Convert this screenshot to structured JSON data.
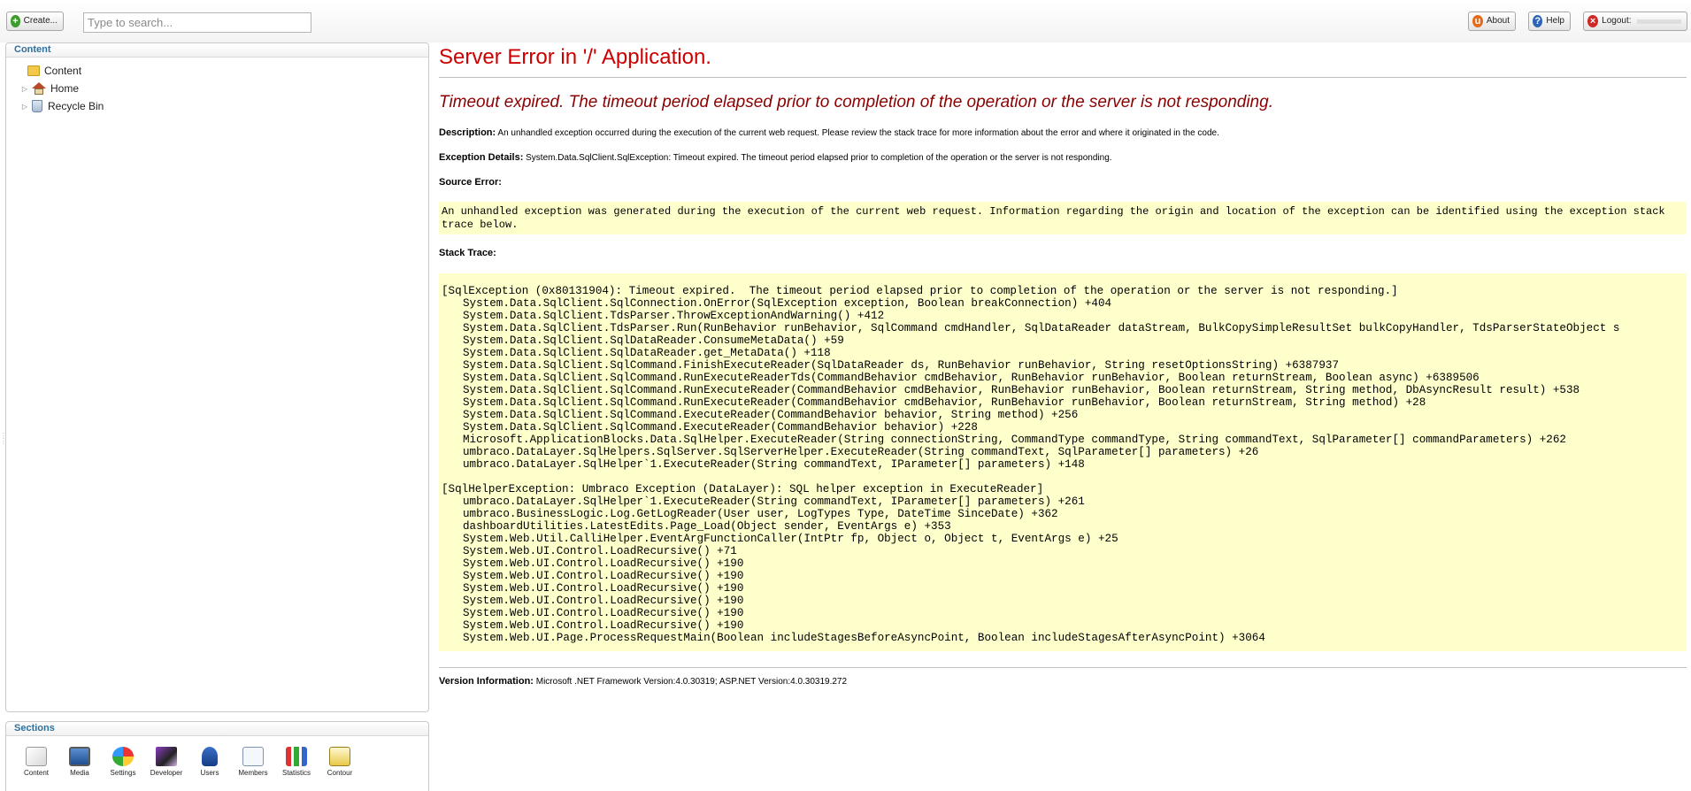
{
  "toolbar": {
    "create_label": "Create...",
    "search_placeholder": "Type to search...",
    "about_label": "About",
    "help_label": "Help",
    "logout_label": "Logout:"
  },
  "content_panel": {
    "title": "Content",
    "tree": [
      {
        "label": "Content",
        "icon": "folder-icon"
      },
      {
        "label": "Home",
        "icon": "home-icon"
      },
      {
        "label": "Recycle Bin",
        "icon": "recycle-bin-icon"
      }
    ]
  },
  "sections_panel": {
    "title": "Sections",
    "items": [
      {
        "label": "Content",
        "icon": "content-icon"
      },
      {
        "label": "Media",
        "icon": "media-icon"
      },
      {
        "label": "Settings",
        "icon": "settings-icon"
      },
      {
        "label": "Developer",
        "icon": "developer-icon"
      },
      {
        "label": "Users",
        "icon": "users-icon"
      },
      {
        "label": "Members",
        "icon": "members-icon"
      },
      {
        "label": "Statistics",
        "icon": "statistics-icon"
      },
      {
        "label": "Contour",
        "icon": "contour-icon"
      }
    ]
  },
  "error": {
    "title": "Server Error in '/' Application.",
    "message": "Timeout expired.  The timeout period elapsed prior to completion of the operation or the server is not responding.",
    "description_label": "Description:",
    "description_text": " An unhandled exception occurred during the execution of the current web request. Please review the stack trace for more information about the error and where it originated in the code.",
    "exception_label": "Exception Details:",
    "exception_text": " System.Data.SqlClient.SqlException: Timeout expired.  The timeout period elapsed prior to completion of the operation or the server is not responding.",
    "source_error_label": "Source Error:",
    "source_error_text": "An unhandled exception was generated during the execution of the current web request. Information regarding the origin and location of the exception can be identified using the exception stack trace below.",
    "stack_trace_label": "Stack Trace:",
    "stack_trace": [
      {
        "text": "[SqlException (0x80131904): Timeout expired.  The timeout period elapsed prior to completion of the operation or the server is not responding.]",
        "indent": false
      },
      {
        "text": "System.Data.SqlClient.SqlConnection.OnError(SqlException exception, Boolean breakConnection) +404",
        "indent": true
      },
      {
        "text": "System.Data.SqlClient.TdsParser.ThrowExceptionAndWarning() +412",
        "indent": true
      },
      {
        "text": "System.Data.SqlClient.TdsParser.Run(RunBehavior runBehavior, SqlCommand cmdHandler, SqlDataReader dataStream, BulkCopySimpleResultSet bulkCopyHandler, TdsParserStateObject s",
        "indent": true
      },
      {
        "text": "System.Data.SqlClient.SqlDataReader.ConsumeMetaData() +59",
        "indent": true
      },
      {
        "text": "System.Data.SqlClient.SqlDataReader.get_MetaData() +118",
        "indent": true
      },
      {
        "text": "System.Data.SqlClient.SqlCommand.FinishExecuteReader(SqlDataReader ds, RunBehavior runBehavior, String resetOptionsString) +6387937",
        "indent": true
      },
      {
        "text": "System.Data.SqlClient.SqlCommand.RunExecuteReaderTds(CommandBehavior cmdBehavior, RunBehavior runBehavior, Boolean returnStream, Boolean async) +6389506",
        "indent": true
      },
      {
        "text": "System.Data.SqlClient.SqlCommand.RunExecuteReader(CommandBehavior cmdBehavior, RunBehavior runBehavior, Boolean returnStream, String method, DbAsyncResult result) +538",
        "indent": true
      },
      {
        "text": "System.Data.SqlClient.SqlCommand.RunExecuteReader(CommandBehavior cmdBehavior, RunBehavior runBehavior, Boolean returnStream, String method) +28",
        "indent": true
      },
      {
        "text": "System.Data.SqlClient.SqlCommand.ExecuteReader(CommandBehavior behavior, String method) +256",
        "indent": true
      },
      {
        "text": "System.Data.SqlClient.SqlCommand.ExecuteReader(CommandBehavior behavior) +228",
        "indent": true
      },
      {
        "text": "Microsoft.ApplicationBlocks.Data.SqlHelper.ExecuteReader(String connectionString, CommandType commandType, String commandText, SqlParameter[] commandParameters) +262",
        "indent": true
      },
      {
        "text": "umbraco.DataLayer.SqlHelpers.SqlServer.SqlServerHelper.ExecuteReader(String commandText, SqlParameter[] parameters) +26",
        "indent": true
      },
      {
        "text": "umbraco.DataLayer.SqlHelper`1.ExecuteReader(String commandText, IParameter[] parameters) +148",
        "indent": true
      },
      {
        "text": "",
        "indent": false
      },
      {
        "text": "[SqlHelperException: Umbraco Exception (DataLayer): SQL helper exception in ExecuteReader]",
        "indent": false
      },
      {
        "text": "umbraco.DataLayer.SqlHelper`1.ExecuteReader(String commandText, IParameter[] parameters) +261",
        "indent": true
      },
      {
        "text": "umbraco.BusinessLogic.Log.GetLogReader(User user, LogTypes Type, DateTime SinceDate) +362",
        "indent": true
      },
      {
        "text": "dashboardUtilities.LatestEdits.Page_Load(Object sender, EventArgs e) +353",
        "indent": true
      },
      {
        "text": "System.Web.Util.CalliHelper.EventArgFunctionCaller(IntPtr fp, Object o, Object t, EventArgs e) +25",
        "indent": true
      },
      {
        "text": "System.Web.UI.Control.LoadRecursive() +71",
        "indent": true
      },
      {
        "text": "System.Web.UI.Control.LoadRecursive() +190",
        "indent": true
      },
      {
        "text": "System.Web.UI.Control.LoadRecursive() +190",
        "indent": true
      },
      {
        "text": "System.Web.UI.Control.LoadRecursive() +190",
        "indent": true
      },
      {
        "text": "System.Web.UI.Control.LoadRecursive() +190",
        "indent": true
      },
      {
        "text": "System.Web.UI.Control.LoadRecursive() +190",
        "indent": true
      },
      {
        "text": "System.Web.UI.Control.LoadRecursive() +190",
        "indent": true
      },
      {
        "text": "System.Web.UI.Page.ProcessRequestMain(Boolean includeStagesBeforeAsyncPoint, Boolean includeStagesAfterAsyncPoint) +3064",
        "indent": true
      }
    ],
    "version_label": "Version Information:",
    "version_text": " Microsoft .NET Framework Version:4.0.30319; ASP.NET Version:4.0.30319.272"
  }
}
